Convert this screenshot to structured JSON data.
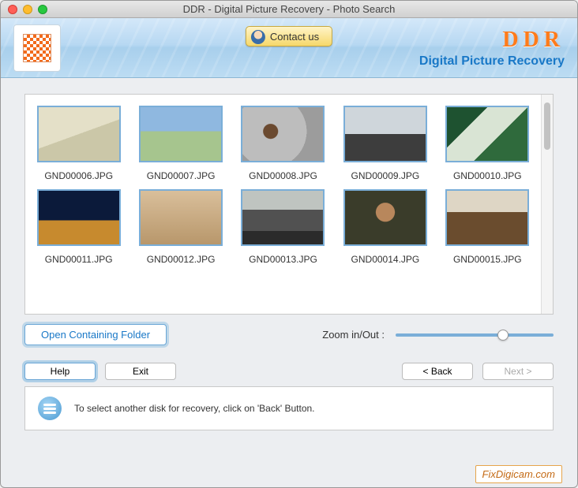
{
  "titlebar": {
    "title": "DDR - Digital Picture Recovery - Photo Search"
  },
  "banner": {
    "contact_label": "Contact us",
    "brand_main": "DDR",
    "brand_sub": "Digital Picture Recovery"
  },
  "thumbs": [
    {
      "label": "GND00006.JPG",
      "cls": "t1"
    },
    {
      "label": "GND00007.JPG",
      "cls": "t2"
    },
    {
      "label": "GND00008.JPG",
      "cls": "t3"
    },
    {
      "label": "GND00009.JPG",
      "cls": "t4"
    },
    {
      "label": "GND00010.JPG",
      "cls": "t5"
    },
    {
      "label": "GND00011.JPG",
      "cls": "t6"
    },
    {
      "label": "GND00012.JPG",
      "cls": "t7"
    },
    {
      "label": "GND00013.JPG",
      "cls": "t8"
    },
    {
      "label": "GND00014.JPG",
      "cls": "t9"
    },
    {
      "label": "GND00015.JPG",
      "cls": "t10"
    }
  ],
  "controls": {
    "open_folder_label": "Open Containing Folder",
    "zoom_label": "Zoom in/Out :"
  },
  "nav": {
    "help": "Help",
    "exit": "Exit",
    "back": "< Back",
    "next": "Next >"
  },
  "hint": {
    "text": "To select another disk for recovery, click on 'Back' Button."
  },
  "watermark": "FixDigicam.com"
}
